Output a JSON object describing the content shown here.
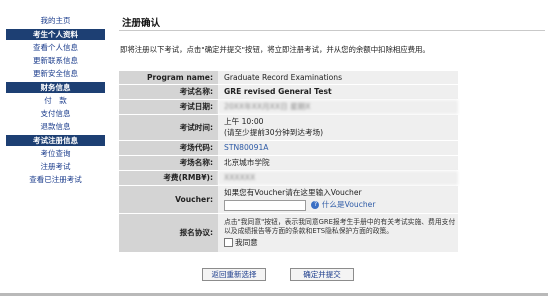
{
  "sidebar": {
    "home": "我的主页",
    "sections": [
      {
        "title": "考生个人资料",
        "items": [
          "查看个人信息",
          "更新联系信息",
          "更新安全信息"
        ]
      },
      {
        "title": "财务信息",
        "items": [
          "付　款",
          "支付信息",
          "退款信息"
        ]
      },
      {
        "title": "考试注册信息",
        "items": [
          "考位查询",
          "注册考试",
          "查看已注册考试"
        ]
      }
    ]
  },
  "page": {
    "title": "注册确认",
    "intro": "即将注册以下考试，点击\"确定并提交\"按钮，将立即注册考试，并从您的余额中扣除相应费用。"
  },
  "form": {
    "program_label": "Program name:",
    "program_value": "Graduate Record Examinations",
    "exam_name_label": "考试名称:",
    "exam_name_value": "GRE revised General Test",
    "exam_date_label": "考试日期:",
    "exam_date_value": "20XX年XX月XX日 星期X",
    "exam_time_label": "考试时间:",
    "exam_time_line1": "上午 10:00",
    "exam_time_line2": "(请至少提前30分钟到达考场)",
    "center_code_label": "考场代码:",
    "center_code_value": "STN80091A",
    "center_name_label": "考场名称:",
    "center_name_value": "北京城市学院",
    "fee_label": "考费(RMB¥):",
    "fee_value": "XXXXXX",
    "voucher_label": "Voucher:",
    "voucher_hint": "如果您有Voucher请在这里输入Voucher",
    "voucher_help": "什么是Voucher",
    "agreement_label": "报名协议:",
    "agreement_text": "点击\"我同意\"按钮，表示我同意GRE报考生手册中的有关考试实施、费用支付以及成绩报告等方面的条款和ETS隐私保护方面的政策。",
    "agree_checkbox_label": "我同意"
  },
  "buttons": {
    "back": "返回重新选择",
    "submit": "确定并提交"
  }
}
